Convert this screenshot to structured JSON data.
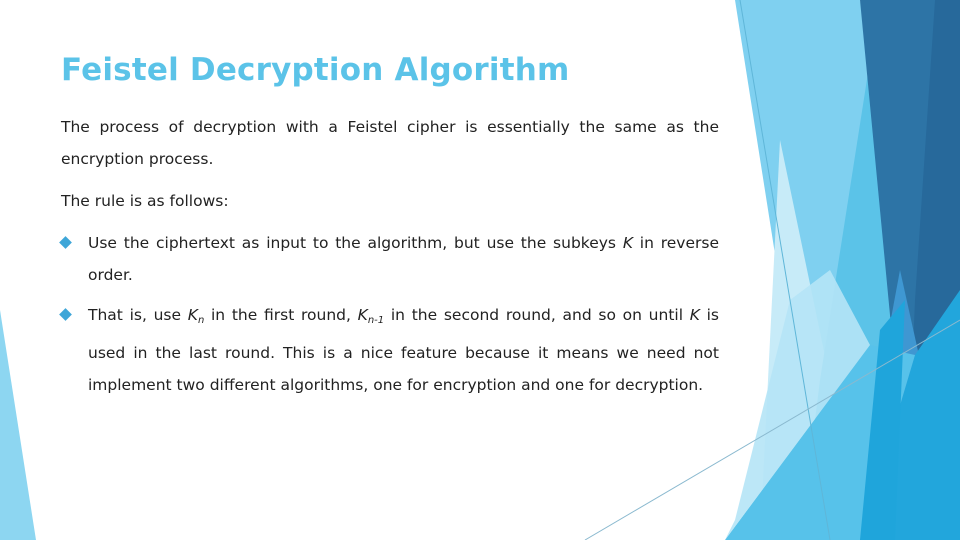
{
  "slide": {
    "title": "Feistel Decryption Algorithm",
    "paragraphs": [
      "The process of decryption with a Feistel cipher is essentially the same as the encryption process.",
      "The rule is as follows:"
    ],
    "bullets": [
      {
        "icon": "diamond-bullet-icon",
        "parts": {
          "t1": "Use the ciphertext as input to the algorithm, but use the subkeys ",
          "k": "K",
          "t2": "  in reverse order."
        }
      },
      {
        "icon": "diamond-bullet-icon",
        "parts": {
          "t1": "That is, use ",
          "k1": "K",
          "s1": "n",
          "t2": "  in the first round, ",
          "k2": "K",
          "s2": "n-1",
          "t3": "  in the second round, and so on until ",
          "k3": "K",
          "t4": " is used in the last round. This is a nice feature because it means we need not implement two different algorithms, one for encryption and one for decryption."
        }
      }
    ]
  },
  "colors": {
    "title": "#5bc3e8",
    "text": "#222222",
    "bullet": "#3ea6d8",
    "deco_light": "#8dd6f1",
    "deco_mid": "#5bc3e8",
    "deco_dark": "#2d74a6",
    "deco_darker": "#27699b",
    "deco_bright": "#22a6dc"
  }
}
